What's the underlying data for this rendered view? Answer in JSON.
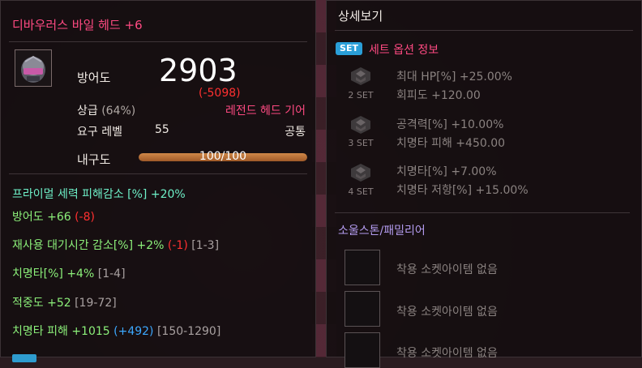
{
  "item": {
    "name": "디바우러스 바일 헤드 +6",
    "defense_label": "방어도",
    "defense_value": "2903",
    "defense_diff": "(-5098)",
    "grade": "상급",
    "grade_pct": "(64%)",
    "legend_label": "레전드 헤드 기어",
    "req_label": "요구 레벨",
    "req_value": "55",
    "req_class": "공통",
    "durability_label": "내구도",
    "durability_text": "100/100",
    "durability_fraction": 1.0
  },
  "stats": [
    {
      "name": "프라이멀 세력 피해감소 [%]",
      "value": "+20%",
      "color": "cyan"
    },
    {
      "name": "방어도",
      "value": "+66",
      "diff": "(-8)",
      "color": "green"
    },
    {
      "name": "재사용 대기시간 감소[%]",
      "value": "+2%",
      "diff": "(-1)",
      "range": "[1-3]",
      "color": "green"
    },
    {
      "name": "치명타[%]",
      "value": "+4%",
      "range": "[1-4]",
      "color": "green"
    },
    {
      "name": "적중도",
      "value": "+52",
      "range": "[19-72]",
      "color": "green"
    },
    {
      "name": "치명타 피해",
      "value": "+1015",
      "bonus": "(+492)",
      "range": "[150-1290]",
      "color": "green"
    }
  ],
  "detail": {
    "title": "상세보기",
    "set_badge": "SET",
    "set_header": "세트 옵션 정보",
    "sets": [
      {
        "count": "2 SET",
        "lines": [
          "최대 HP[%] +25.00%",
          "회피도 +120.00"
        ]
      },
      {
        "count": "3 SET",
        "lines": [
          "공격력[%] +10.00%",
          "치명타 피해 +450.00"
        ]
      },
      {
        "count": "4 SET",
        "lines": [
          "치명타[%] +7.00%",
          "치명타 저항[%] +15.00%"
        ]
      }
    ],
    "soul_title": "소울스톤/패밀리어",
    "sockets": [
      "착용 소켓아이템 없음",
      "착용 소켓아이템 없음",
      "착용 소켓아이템 없음"
    ]
  },
  "colors": {
    "name_pink": "#ff4a82",
    "stat_cyan": "#6ef0c8",
    "stat_green": "#8cf07a",
    "diff_red": "#ff3030",
    "bonus_blue": "#3ca8ff",
    "soul_purple": "#b49cf0",
    "set_badge_blue": "#2a9fd8"
  }
}
